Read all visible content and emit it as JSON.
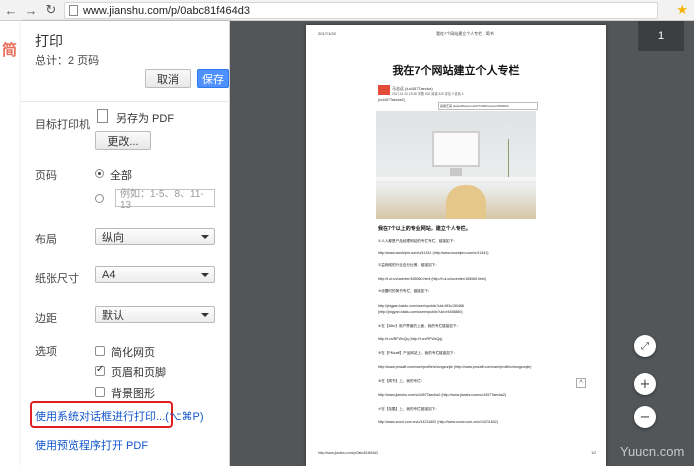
{
  "browser": {
    "back_icon": "back-arrow-icon",
    "forward_icon": "forward-arrow-icon",
    "reload_icon": "reload-icon",
    "url": "www.jianshu.com/p/0abc81f464d3"
  },
  "print_panel": {
    "title": "打印",
    "total": "总计：2 页码",
    "cancel_label": "取消",
    "save_label": "保存",
    "destination_label": "目标打印机",
    "destination_value": "另存为 PDF",
    "change_label": "更改...",
    "pages_label": "页码",
    "pages_all": "全部",
    "pages_custom_placeholder": "例如：1-5、8、11-13",
    "layout_label": "布局",
    "layout_value": "纵向",
    "paper_label": "纸张尺寸",
    "paper_value": "A4",
    "margins_label": "边距",
    "margins_value": "默认",
    "options_label": "选项",
    "options": [
      {
        "label": "简化网页",
        "checked": false
      },
      {
        "label": "页眉和页脚",
        "checked": true
      },
      {
        "label": "背景图形",
        "checked": false
      }
    ],
    "system_dialog_link": "使用系统对话框进行打印...(⌥⌘P)",
    "preview_open_link": "使用预览程序打开 PDF"
  },
  "preview": {
    "page_number": "1",
    "sheet": {
      "date": "2017/1/20",
      "header": "我在7个网站建立个人专栏 - 简书",
      "title": "我在7个网站建立个人专栏",
      "author": "马志远 (lu4457Taecba)",
      "meta": "2017.01.20 19:38  字数 602  阅读 320  评论 0  喜欢 4",
      "handle": "(lu4457Taecba2)",
      "quote": "感谢王哥 (lsdoeffhssivomd3773396/notes/4780000)",
      "subtitle": "我在7个以上的专业网站，建立个人专栏。",
      "lines": [
        "①人人都是产品经理网站的专栏专栏，链接如下：",
        "http://www.woshipm.com/u/41341 (http://www.woshipm.com/u/41341)",
        "②益网络的行业百分比博，链接如下：",
        "http://t.ui.cn/ucenter/165060.html (http://t.ui.cn/ucenter/165060.html)",
        "③设置时的简书专栏，链接如下：",
        "http://jingyan.baidu.com/user/npublic?uid=f63c150466",
        "(http://jingyan.baidu.com/user/npublic?uid=f4458880)",
        "④在【36kr】用户界面的上面，我的专栏链接如下：",
        "http://t.cn/RFWxQq (http://t.cn/RFWxQq)",
        "⑤在【PMcaff】产品网站上，我的专栏链接如下：",
        "http://www.pmcaff.com/user/profile/zhongzunjie (http://www.pmcaff.com/user/profile/zhongzunjie)",
        "⑥在【简书】上，我的专栏：",
        "http://www.jianshu.com/u/4457Taecba2 (http://www.jianshu.com/u/4457Taecba2)",
        "⑦在【站酷】上，我的专栏链接如下：",
        "http://www.zcool.com.cn/u/14211602 (http://www.zcool.com.cn/u/14211602)"
      ],
      "footer": "http://www.jianshu.com/p/0abc81f464d3",
      "footer_page": "1/2"
    }
  },
  "underlying_page": {
    "logo": "简"
  },
  "watermark": "Yuucn.com"
}
